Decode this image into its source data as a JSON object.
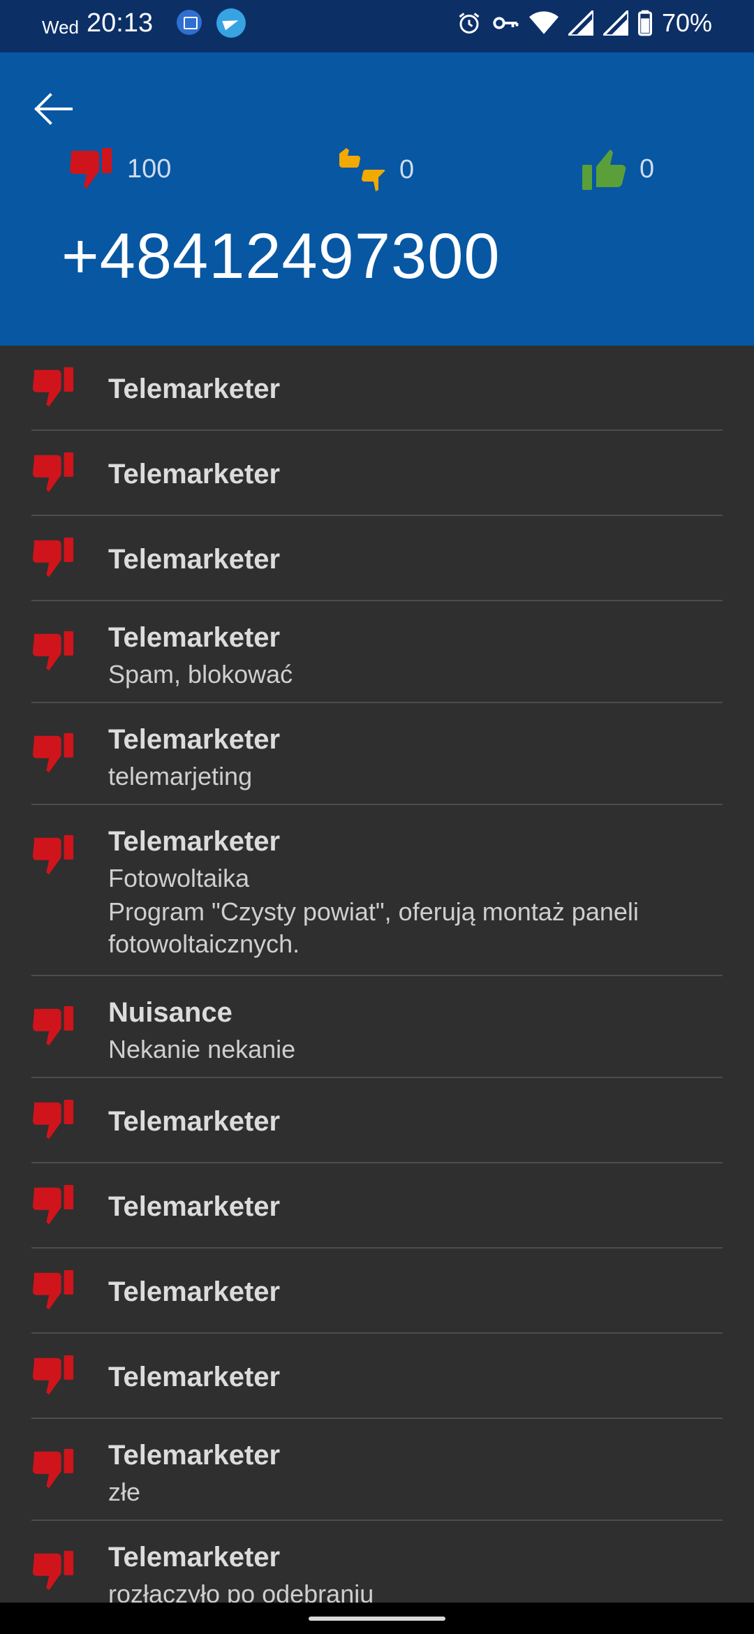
{
  "status_bar": {
    "day": "Wed",
    "time": "20:13",
    "battery": "70%"
  },
  "header": {
    "negative_count": "100",
    "neutral_count": "0",
    "positive_count": "0",
    "phone_number": "+48412497300"
  },
  "reports": [
    {
      "category": "Telemarketer",
      "comment": "",
      "comment2": ""
    },
    {
      "category": "Telemarketer",
      "comment": "",
      "comment2": ""
    },
    {
      "category": "Telemarketer",
      "comment": "",
      "comment2": ""
    },
    {
      "category": "Telemarketer",
      "comment": "Spam, blokować",
      "comment2": ""
    },
    {
      "category": "Telemarketer",
      "comment": "telemarjeting",
      "comment2": ""
    },
    {
      "category": "Telemarketer",
      "comment": "Fotowoltaika",
      "comment2": "Program \"Czysty powiat\", oferują montaż paneli fotowoltaicznych."
    },
    {
      "category": "Nuisance",
      "comment": "Nekanie nekanie",
      "comment2": ""
    },
    {
      "category": "Telemarketer",
      "comment": "",
      "comment2": ""
    },
    {
      "category": "Telemarketer",
      "comment": "",
      "comment2": ""
    },
    {
      "category": "Telemarketer",
      "comment": "",
      "comment2": ""
    },
    {
      "category": "Telemarketer",
      "comment": "",
      "comment2": ""
    },
    {
      "category": "Telemarketer",
      "comment": "złe",
      "comment2": ""
    },
    {
      "category": "Telemarketer",
      "comment": "rozłączyło po odebraniu",
      "comment2": ""
    }
  ],
  "icons": {
    "negative": "thumbs-down-icon",
    "neutral": "thumbs-neutral-icon",
    "positive": "thumbs-up-icon"
  },
  "colors": {
    "header_bg": "#0757a3",
    "status_bg": "#0c2f66",
    "list_bg": "#2f2f2f",
    "negative": "#d0141b",
    "neutral": "#f2a900",
    "positive": "#5b9f3a"
  }
}
